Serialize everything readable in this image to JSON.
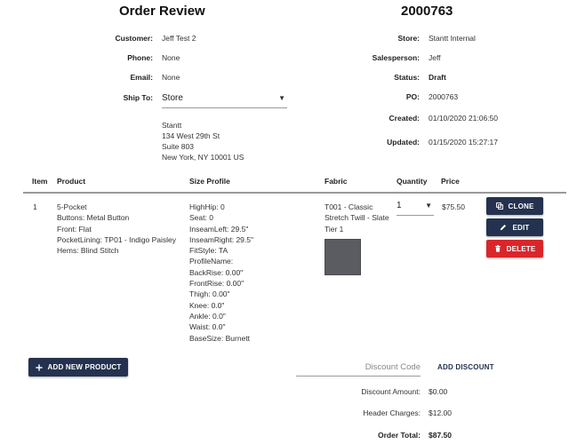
{
  "header": {
    "title": "Order Review",
    "order_number": "2000763"
  },
  "customer_info": {
    "customer_label": "Customer:",
    "customer_value": "Jeff Test 2",
    "phone_label": "Phone:",
    "phone_value": "None",
    "email_label": "Email:",
    "email_value": "None",
    "ship_to_label": "Ship To:",
    "ship_to_value": "Store",
    "address": [
      "Stantt",
      "134 West 29th St",
      "Suite 803",
      "New York, NY 10001 US"
    ]
  },
  "order_info": {
    "store_label": "Store:",
    "store_value": "Stantt Internal",
    "salesperson_label": "Salesperson:",
    "salesperson_value": "Jeff",
    "status_label": "Status:",
    "status_value": "Draft",
    "po_label": "PO:",
    "po_value": "2000763",
    "created_label": "Created:",
    "created_value": "01/10/2020 21:06:50",
    "updated_label": "Updated:",
    "updated_value": "01/15/2020 15:27:17"
  },
  "table": {
    "columns": [
      "Item",
      "Product",
      "Size Profile",
      "Fabric",
      "Quantity",
      "Price"
    ],
    "rows": [
      {
        "item": "1",
        "product": [
          "5-Pocket",
          "Buttons: Metal Button",
          "Front: Flat",
          "PocketLining: TP01 - Indigo Paisley",
          "Hems: Blind Stitch"
        ],
        "size_profile": [
          "HighHip: 0",
          "Seat: 0",
          "InseamLeft: 29.5\"",
          "InseamRight: 29.5\"",
          "FitStyle: TA",
          "ProfileName:",
          "BackRise: 0.00\"",
          "FrontRise: 0.00\"",
          "Thigh: 0.00\"",
          "Knee: 0.0\"",
          "Ankle: 0.0\"",
          "Waist: 0.0\"",
          "BaseSize: Burnett"
        ],
        "fabric": [
          "T001 - Classic",
          "Stretch Twill - Slate",
          "Tier 1"
        ],
        "fabric_swatch_color": "#5b5c61",
        "quantity": "1",
        "price": "$75.50",
        "actions": {
          "clone": "CLONE",
          "edit": "EDIT",
          "delete": "DELETE"
        }
      }
    ]
  },
  "footer": {
    "add_product_label": "ADD NEW PRODUCT",
    "discount_placeholder": "Discount Code",
    "add_discount_label": "ADD DISCOUNT",
    "discount_amount_label": "Discount Amount:",
    "discount_amount_value": "$0.00",
    "header_charges_label": "Header Charges:",
    "header_charges_value": "$12.00",
    "order_total_label": "Order Total:",
    "order_total_value": "$87.50"
  },
  "colors": {
    "primary_navy": "#24324f",
    "danger_red": "#d9262b"
  }
}
